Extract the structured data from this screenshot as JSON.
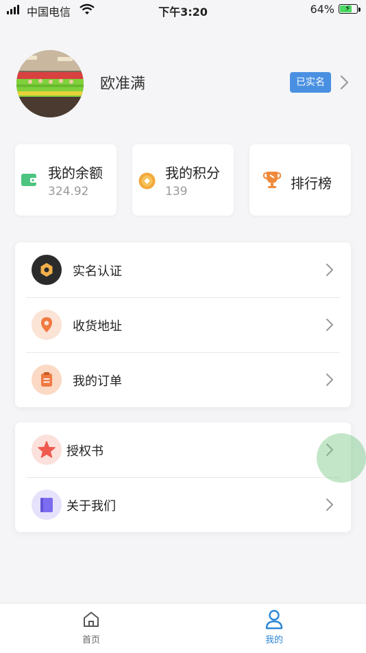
{
  "status_bar": {
    "carrier": "中国电信",
    "time": "下午3:20",
    "battery": "64%"
  },
  "profile": {
    "name": "欧准满",
    "badge": "已实名"
  },
  "stats": [
    {
      "title": "我的余额",
      "value": "324.92",
      "icon": "wallet-icon",
      "color": "#4cc47f"
    },
    {
      "title": "我的积分",
      "value": "139",
      "icon": "coin-icon",
      "color": "#f2a93b"
    },
    {
      "title": "排行榜",
      "value": "",
      "icon": "trophy-icon",
      "color": "#ef8a3c"
    }
  ],
  "menu_main": [
    {
      "label": "实名认证",
      "icon": "verify-icon",
      "color": "#2b2b2b"
    },
    {
      "label": "收货地址",
      "icon": "location-pin-icon",
      "color": "#ef7a42"
    },
    {
      "label": "我的订单",
      "icon": "order-clipboard-icon",
      "color": "#ef7a42"
    }
  ],
  "menu_secondary": [
    {
      "label": "授权书",
      "icon": "star-icon",
      "color": "#ef5b4f"
    },
    {
      "label": "关于我们",
      "icon": "book-icon",
      "color": "#7b6cf0"
    }
  ],
  "tabs": [
    {
      "label": "首页",
      "icon": "home-icon",
      "active": false
    },
    {
      "label": "我的",
      "icon": "user-icon",
      "active": true
    }
  ],
  "colors": {
    "accent": "#2d86d6",
    "badge": "#4a90e2",
    "background": "#f5f5f7"
  }
}
